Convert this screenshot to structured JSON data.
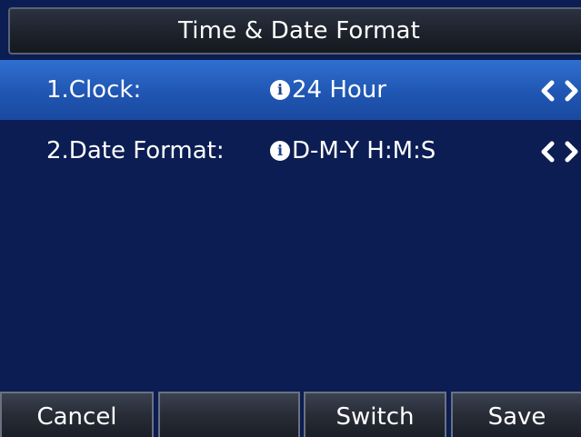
{
  "header": {
    "title": "Time & Date Format"
  },
  "menu": {
    "items": [
      {
        "label": "1.Clock:",
        "info_icon": "info-icon",
        "value": "24 Hour",
        "arrows_icon": "left-right-arrows-icon",
        "selected": true
      },
      {
        "label": "2.Date Format:",
        "info_icon": "info-icon",
        "value": "D-M-Y H:M:S",
        "arrows_icon": "left-right-arrows-icon",
        "selected": false
      }
    ]
  },
  "softkeys": {
    "items": [
      {
        "label": "Cancel"
      },
      {
        "label": ""
      },
      {
        "label": "Switch"
      },
      {
        "label": "Save"
      }
    ]
  },
  "colors": {
    "background": "#0b1d52",
    "selected_row": "#2a63c4",
    "softkey_bg": "#2a2f3a",
    "text": "#ffffff"
  }
}
